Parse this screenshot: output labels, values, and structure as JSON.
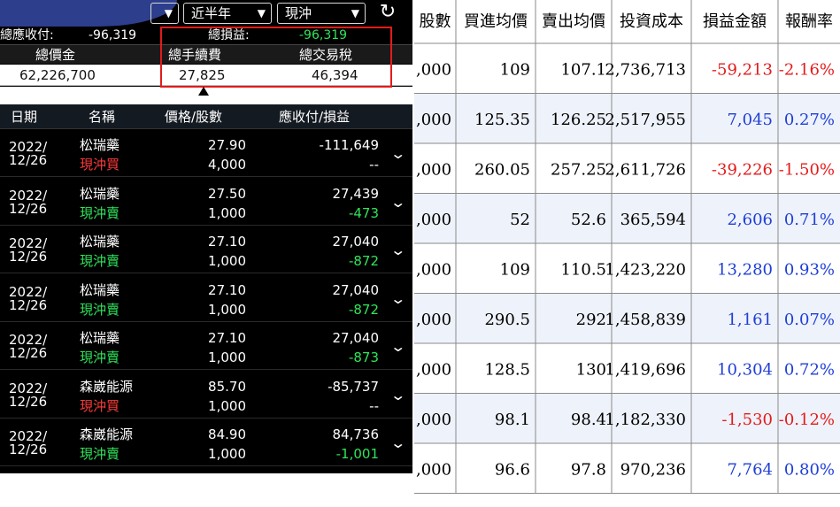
{
  "toolbar": {
    "period_label": "近半年",
    "type_label": "現沖",
    "chevron": "▼",
    "refresh_glyph": "↻"
  },
  "summary": {
    "receivable_label": "總應收付:",
    "receivable_value": "-96,319",
    "pnl_label": "總損益:",
    "pnl_value": "-96,319",
    "total_price_label": "總價金",
    "fee_label": "總手續費",
    "tax_label": "總交易稅",
    "total_price_value": "62,226,700",
    "fee_value": "27,825",
    "tax_value": "46,394"
  },
  "list": {
    "headers": {
      "date": "日期",
      "name": "名稱",
      "price_qty": "價格/股數",
      "amount_pnl": "應收付/損益"
    },
    "rows": [
      {
        "date1": "2022/",
        "date2": "12/26",
        "name": "松瑞藥",
        "type": "現沖買",
        "type_color": "red",
        "price": "27.90",
        "qty": "4,000",
        "amount": "-111,649",
        "pnl": "--",
        "pnl_color": "white"
      },
      {
        "date1": "2022/",
        "date2": "12/26",
        "name": "松瑞藥",
        "type": "現沖賣",
        "type_color": "green",
        "price": "27.50",
        "qty": "1,000",
        "amount": "27,439",
        "pnl": "-473",
        "pnl_color": "green"
      },
      {
        "date1": "2022/",
        "date2": "12/26",
        "name": "松瑞藥",
        "type": "現沖賣",
        "type_color": "green",
        "price": "27.10",
        "qty": "1,000",
        "amount": "27,040",
        "pnl": "-872",
        "pnl_color": "green"
      },
      {
        "date1": "2022/",
        "date2": "12/26",
        "name": "松瑞藥",
        "type": "現沖賣",
        "type_color": "green",
        "price": "27.10",
        "qty": "1,000",
        "amount": "27,040",
        "pnl": "-872",
        "pnl_color": "green"
      },
      {
        "date1": "2022/",
        "date2": "12/26",
        "name": "松瑞藥",
        "type": "現沖賣",
        "type_color": "green",
        "price": "27.10",
        "qty": "1,000",
        "amount": "27,040",
        "pnl": "-873",
        "pnl_color": "green"
      },
      {
        "date1": "2022/",
        "date2": "12/26",
        "name": "森崴能源",
        "type": "現沖買",
        "type_color": "red",
        "price": "85.70",
        "qty": "1,000",
        "amount": "-85,737",
        "pnl": "--",
        "pnl_color": "white"
      },
      {
        "date1": "2022/",
        "date2": "12/26",
        "name": "森崴能源",
        "type": "現沖賣",
        "type_color": "green",
        "price": "84.90",
        "qty": "1,000",
        "amount": "84,736",
        "pnl": "-1,001",
        "pnl_color": "green"
      }
    ]
  },
  "table": {
    "headers": [
      "股數",
      "買進均價",
      "賣出均價",
      "投資成本",
      "損益金額",
      "報酬率"
    ],
    "rows": [
      {
        "shares": ",000",
        "buy": "109",
        "sell": "107.1",
        "cost": "2,736,713",
        "pnl": "-59,213",
        "ret": "-2.16%",
        "sign": "neg"
      },
      {
        "shares": ",000",
        "buy": "125.35",
        "sell": "126.25",
        "cost": "2,517,955",
        "pnl": "7,045",
        "ret": "0.27%",
        "sign": "pos"
      },
      {
        "shares": ",000",
        "buy": "260.05",
        "sell": "257.25",
        "cost": "2,611,726",
        "pnl": "-39,226",
        "ret": "-1.50%",
        "sign": "neg"
      },
      {
        "shares": ",000",
        "buy": "52",
        "sell": "52.6",
        "cost": "365,594",
        "pnl": "2,606",
        "ret": "0.71%",
        "sign": "pos"
      },
      {
        "shares": ",000",
        "buy": "109",
        "sell": "110.5",
        "cost": "1,423,220",
        "pnl": "13,280",
        "ret": "0.93%",
        "sign": "pos"
      },
      {
        "shares": ",000",
        "buy": "290.5",
        "sell": "292",
        "cost": "1,458,839",
        "pnl": "1,161",
        "ret": "0.07%",
        "sign": "pos"
      },
      {
        "shares": ",000",
        "buy": "128.5",
        "sell": "130",
        "cost": "1,419,696",
        "pnl": "10,304",
        "ret": "0.72%",
        "sign": "pos"
      },
      {
        "shares": ",000",
        "buy": "98.1",
        "sell": "98.4",
        "cost": "1,182,330",
        "pnl": "-1,530",
        "ret": "-0.12%",
        "sign": "neg"
      },
      {
        "shares": ",000",
        "buy": "96.6",
        "sell": "97.8",
        "cost": "970,236",
        "pnl": "7,764",
        "ret": "0.80%",
        "sign": "pos"
      }
    ]
  },
  "colors": {
    "negative_red": "#e31b1b",
    "positive_blue": "#1f3fd6",
    "app_green": "#2ee55a",
    "app_red": "#ff3a3a",
    "row_alt": "#eef2fa",
    "highlight_box": "#e31b1b"
  }
}
